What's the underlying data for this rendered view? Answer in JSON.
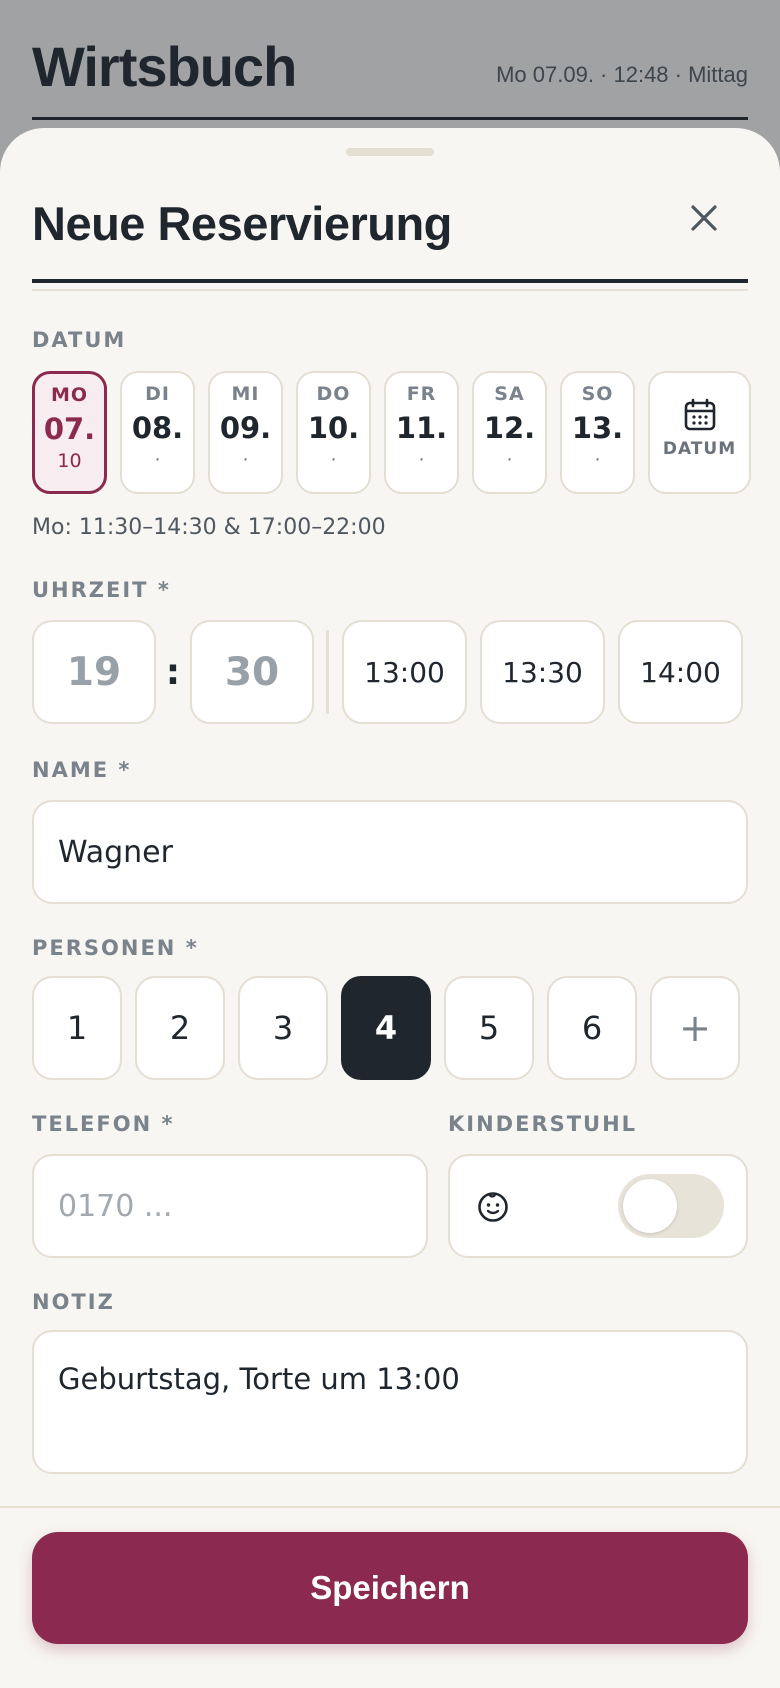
{
  "background": {
    "app_title": "Wirtsbuch",
    "meta": "Mo 07.09. · 12:48 · Mittag"
  },
  "sheet": {
    "title": "Neue Reservierung",
    "close_icon": "close-icon"
  },
  "datum": {
    "label": "DATUM",
    "days": [
      {
        "dow": "MO",
        "day": "07.",
        "count": "10",
        "selected": true
      },
      {
        "dow": "DI",
        "day": "08.",
        "count": "·",
        "selected": false
      },
      {
        "dow": "MI",
        "day": "09.",
        "count": "·",
        "selected": false
      },
      {
        "dow": "DO",
        "day": "10.",
        "count": "·",
        "selected": false
      },
      {
        "dow": "FR",
        "day": "11.",
        "count": "·",
        "selected": false
      },
      {
        "dow": "SA",
        "day": "12.",
        "count": "·",
        "selected": false
      },
      {
        "dow": "SO",
        "day": "13.",
        "count": "·",
        "selected": false
      }
    ],
    "picker_label": "DATUM",
    "picker_icon": "calendar-icon",
    "hours": "Mo: 11:30–14:30 & 17:00–22:00"
  },
  "uhrzeit": {
    "label": "UHRZEIT *",
    "hour_placeholder": "19",
    "minute_placeholder": "30",
    "separator": ":",
    "quick": [
      "13:00",
      "13:30",
      "14:00"
    ]
  },
  "name": {
    "label": "NAME *",
    "value": "Wagner"
  },
  "personen": {
    "label": "PERSONEN *",
    "options": [
      "1",
      "2",
      "3",
      "4",
      "5",
      "6"
    ],
    "selected": "4",
    "more": "+"
  },
  "telefon": {
    "label": "TELEFON *",
    "placeholder": "0170 ..."
  },
  "kinderstuhl": {
    "label": "KINDERSTUHL",
    "icon": "baby-icon",
    "enabled": false
  },
  "notiz": {
    "label": "NOTIZ",
    "value": "Geburtstag, Torte um 13:00"
  },
  "actions": {
    "save_label": "Speichern"
  },
  "colors": {
    "accent": "#8b2a4e",
    "ink": "#1f262d",
    "sheet_bg": "#f8f6f2",
    "border": "#e4ded3"
  }
}
